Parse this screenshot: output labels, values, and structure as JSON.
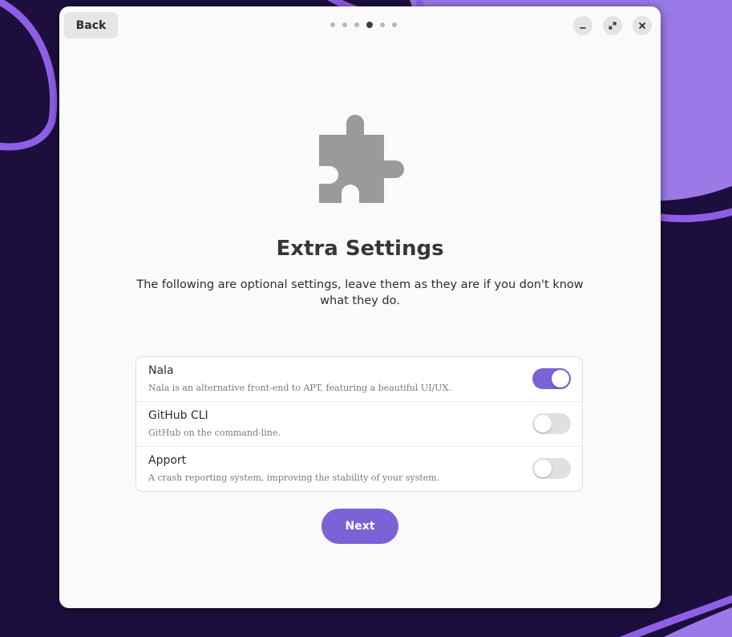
{
  "window": {
    "back_label": "Back",
    "page_indicator": {
      "total": 6,
      "current": 4
    },
    "controls": {
      "minimize_icon": "minimize-icon",
      "maximize_icon": "maximize-icon",
      "close_icon": "close-icon"
    }
  },
  "page": {
    "icon": "puzzle-piece-icon",
    "title": "Extra Settings",
    "description": "The following are optional settings, leave them as they are if you don't know what they do."
  },
  "options": [
    {
      "title": "Nala",
      "subtitle": "Nala is an alternative front-end to APT, featuring a beautiful UI/UX.",
      "enabled": true
    },
    {
      "title": "GitHub CLI",
      "subtitle": "GitHub on the command-line.",
      "enabled": false
    },
    {
      "title": "Apport",
      "subtitle": "A crash reporting system, improving the stability of your system.",
      "enabled": false
    }
  ],
  "next_label": "Next",
  "colors": {
    "accent": "#7b62d7",
    "wallpaper_dark": "#1d0f3d",
    "wallpaper_light": "#9b7ae8",
    "icon_gray": "#9a9a9a"
  }
}
